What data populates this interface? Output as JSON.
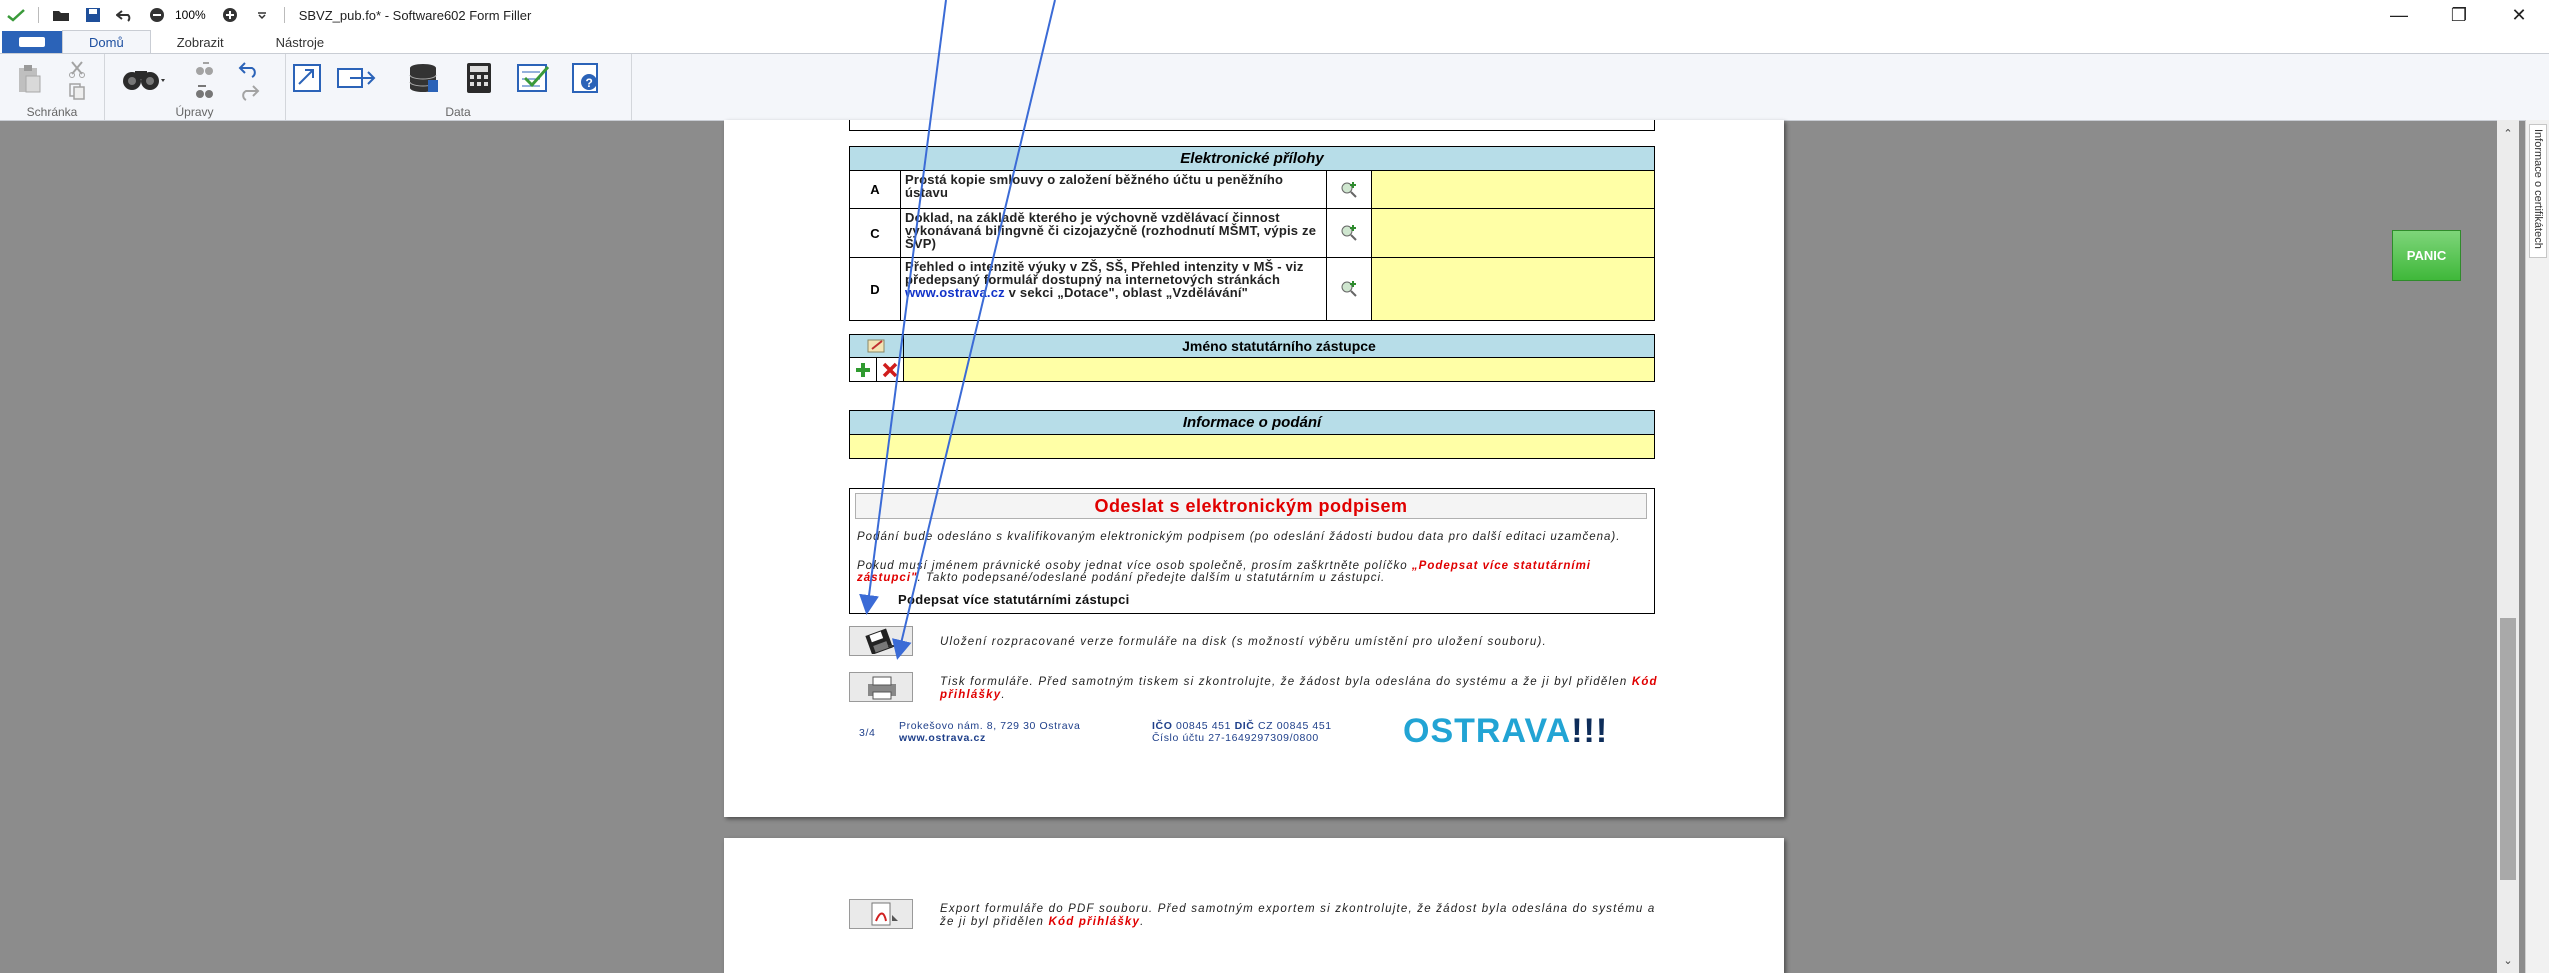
{
  "window": {
    "title": "SBVZ_pub.fo* - Software602 Form Filler",
    "zoom": "100%"
  },
  "tabs": [
    "Domů",
    "Zobrazit",
    "Nástroje"
  ],
  "ribbon_groups": {
    "clipboard": "Schránka",
    "edit": "Úpravy",
    "data": "Data"
  },
  "panic_label": "PANIC",
  "side_panel_label": "Informace o certifikátech",
  "attachments": {
    "header": "Elektronické přílohy",
    "rows": [
      {
        "code": "A",
        "text": "Prostá kopie smlouvy o založení běžného účtu u peněžního ústavu"
      },
      {
        "code": "C",
        "text": "Doklad, na základě kterého je výchovně vzdělávací činnost vykonávaná bilingvně či cizojazyčně (rozhodnutí MŠMT, výpis ze ŠVP)"
      },
      {
        "code": "D",
        "text_before": "Přehled o intenzitě výuky v ZŠ, SŠ, Přehled intenzity v MŠ - viz předepsaný formulář dostupný na internetových stránkách ",
        "link": "www.ostrava.cz",
        "text_after": " v sekci „Dotace\", oblast „Vzdělávání\""
      }
    ]
  },
  "statutory": {
    "header": "Jméno statutárního zástupce"
  },
  "submission_info": {
    "header": "Informace o podání"
  },
  "sign": {
    "title": "Odeslat s elektronickým podpisem",
    "para1": "Podání bude odesláno s kvalifikovaným elektronickým podpisem (po odeslání žádosti budou data pro další editaci uzamčena).",
    "para2_before": "Pokud musí jménem právnické osoby jednat více osob společně, prosím zaškrtněte políčko ",
    "para2_red": "„Podepsat více statutárními zástupci\"",
    "para2_after": ". Takto podepsané/odeslané podání předejte dalším u statutárním u zástupci.",
    "checkbox_label": "Podepsat více statutárními zástupci"
  },
  "actions": {
    "save_text": "Uložení rozpracované verze formuláře na disk (s možností výběru umístění pro uložení souboru).",
    "print_text_before": "Tisk formuláře. Před samotným tiskem si zkontrolujte, že žádost byla odeslána do systému a že ji byl přidělen ",
    "print_text_red": "Kód přihlášky",
    "export_text_before": "Export formuláře do PDF souboru. Před samotným exportem si zkontrolujte, že žádost byla odeslána do systému a že ji byl přidělen ",
    "export_text_red": "Kód přihlášky"
  },
  "footer": {
    "page": "3/4",
    "address": "Prokešovo nám. 8, 729 30 Ostrava",
    "web": "www.ostrava.cz",
    "ico_label": "IČO",
    "ico": "00845 451",
    "dic_label": "DIČ",
    "dic": "CZ 00845 451",
    "account": "Číslo účtu 27-1649297309/0800",
    "logo_word": "OSTRAVA",
    "logo_bang": "!!!"
  },
  "colors": {
    "ribbon_blue": "#2b63b8",
    "header_cyan": "#b7dde8",
    "field_yellow": "#ffffa6",
    "accent_red": "#e00000",
    "logo_blue": "#22a4d4",
    "arrow_blue": "#3b6bd6"
  }
}
